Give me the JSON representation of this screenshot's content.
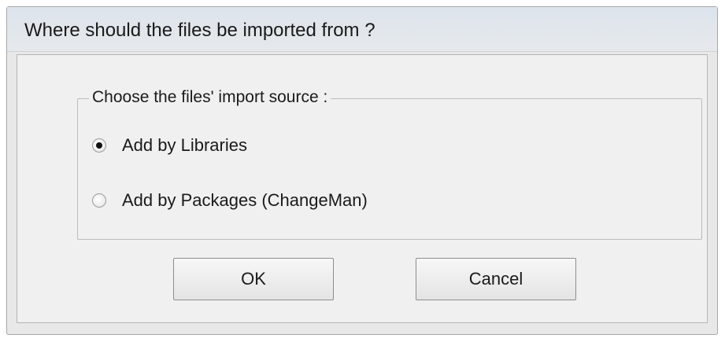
{
  "window": {
    "title": "Where should the files be imported from ?"
  },
  "group": {
    "legend": "Choose the files' import source :",
    "options": [
      {
        "label": "Add by Libraries",
        "selected": true
      },
      {
        "label": "Add by Packages (ChangeMan)",
        "selected": false
      }
    ]
  },
  "buttons": {
    "ok_label": "OK",
    "cancel_label": "Cancel"
  }
}
